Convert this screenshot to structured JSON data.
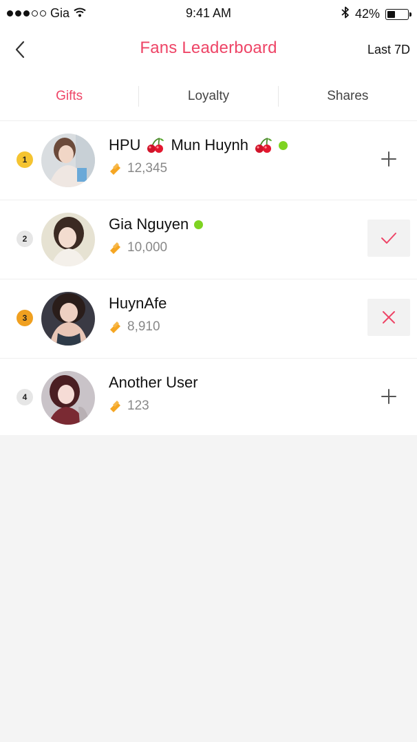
{
  "status_bar": {
    "carrier": "Gia",
    "time": "9:41 AM",
    "battery": "42%",
    "battery_level": 0.42,
    "icons": [
      "signal-dots",
      "wifi-icon",
      "bluetooth-icon",
      "battery-icon"
    ]
  },
  "nav": {
    "title": "Fans Leaderboard",
    "range_label": "Last 7D",
    "back_icon": "chevron-left-icon"
  },
  "tabs": [
    {
      "label": "Gifts",
      "active": true
    },
    {
      "label": "Loyalty",
      "active": false
    },
    {
      "label": "Shares",
      "active": false
    }
  ],
  "colors": {
    "accent": "#ee4466",
    "online": "#7ed321",
    "rank_gold": "#f5c431",
    "rank_silver": "#e6e6e6",
    "rank_bronze": "#f0a020",
    "gift_icon": "#f5a623"
  },
  "fans": [
    {
      "rank": "1",
      "name_parts": [
        "HPU",
        "Mun Huynh"
      ],
      "name_has_cherries": true,
      "online": true,
      "score": "12,345",
      "action": "add",
      "rank_color": "#f5c431"
    },
    {
      "rank": "2",
      "name": "Gia Nguyen",
      "online": true,
      "score": "10,000",
      "action": "followed",
      "rank_color": "#e6e6e6"
    },
    {
      "rank": "3",
      "name": "HuynAfe",
      "online": false,
      "score": "8,910",
      "action": "remove",
      "rank_color": "#f0a020"
    },
    {
      "rank": "4",
      "name": "Another User",
      "online": false,
      "score": "123",
      "action": "add",
      "rank_color": "#e6e6e6"
    }
  ]
}
